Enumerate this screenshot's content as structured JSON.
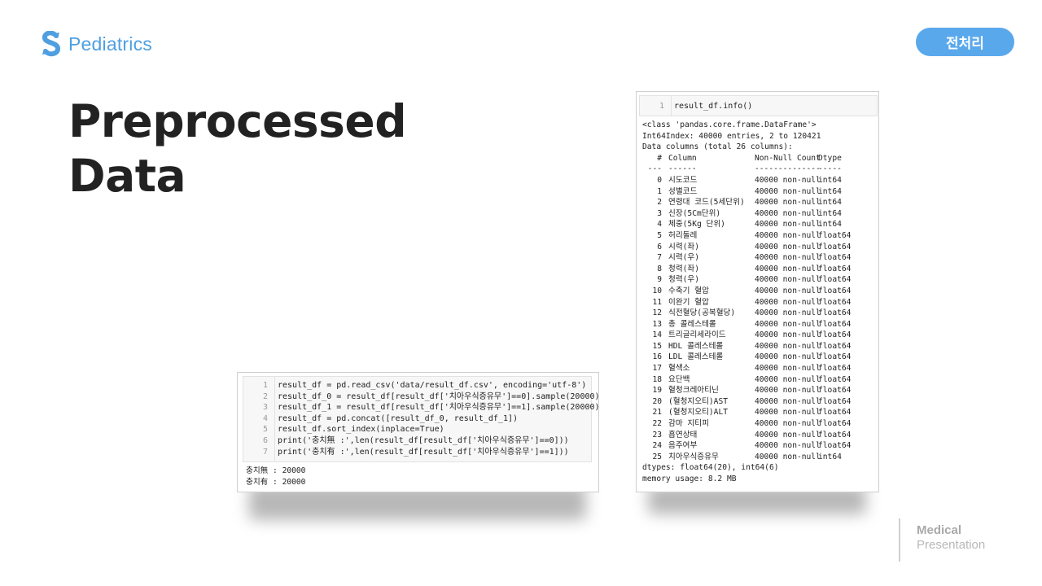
{
  "brand": {
    "name": "Pediatrics"
  },
  "tag": {
    "label": "전처리"
  },
  "title": {
    "line1": "Preprocessed",
    "line2": "Data"
  },
  "colors": {
    "accent": "#5aa8ec",
    "brand": "#4f9fe0",
    "title": "#222222"
  },
  "code_panel": {
    "lines": [
      {
        "n": "1",
        "code": "result_df = pd.read_csv('data/result_df.csv', encoding='utf-8')"
      },
      {
        "n": "2",
        "code": "result_df_0 = result_df[result_df['치아우식증유무']==0].sample(20000)"
      },
      {
        "n": "3",
        "code": "result_df_1 = result_df[result_df['치아우식증유무']==1].sample(20000)"
      },
      {
        "n": "4",
        "code": "result_df = pd.concat([result_df_0, result_df_1])"
      },
      {
        "n": "5",
        "code": "result_df.sort_index(inplace=True)"
      },
      {
        "n": "6",
        "code": "print('충치無 :',len(result_df[result_df['치아우식증유무']==0]))"
      },
      {
        "n": "7",
        "code": "print('충치有 :',len(result_df[result_df['치아우식증유무']==1]))"
      }
    ],
    "output": [
      "충치無 : 20000",
      "충치有 : 20000"
    ]
  },
  "info_panel": {
    "code_line": {
      "n": "1",
      "code": "result_df.info()"
    },
    "header_lines": [
      "<class 'pandas.core.frame.DataFrame'>",
      "Int64Index: 40000 entries, 2 to 120421",
      "Data columns (total 26 columns):"
    ],
    "columns_header": {
      "idx": "#",
      "name": "Column",
      "count": "Non-Null Count",
      "dtype": "Dtype"
    },
    "columns_sep": {
      "idx": "---",
      "name": "------",
      "count": "--------------",
      "dtype": "-----"
    },
    "rows": [
      {
        "idx": "0",
        "name": "시도코드",
        "count": "40000 non-null",
        "dtype": "int64"
      },
      {
        "idx": "1",
        "name": "성별코드",
        "count": "40000 non-null",
        "dtype": "int64"
      },
      {
        "idx": "2",
        "name": "연령대 코드(5세단위)",
        "count": "40000 non-null",
        "dtype": "int64"
      },
      {
        "idx": "3",
        "name": "신장(5Cm단위)",
        "count": "40000 non-null",
        "dtype": "int64"
      },
      {
        "idx": "4",
        "name": "체중(5Kg 단위)",
        "count": "40000 non-null",
        "dtype": "int64"
      },
      {
        "idx": "5",
        "name": "허리둘레",
        "count": "40000 non-null",
        "dtype": "float64"
      },
      {
        "idx": "6",
        "name": "시력(좌)",
        "count": "40000 non-null",
        "dtype": "float64"
      },
      {
        "idx": "7",
        "name": "시력(우)",
        "count": "40000 non-null",
        "dtype": "float64"
      },
      {
        "idx": "8",
        "name": "청력(좌)",
        "count": "40000 non-null",
        "dtype": "float64"
      },
      {
        "idx": "9",
        "name": "청력(우)",
        "count": "40000 non-null",
        "dtype": "float64"
      },
      {
        "idx": "10",
        "name": "수축기 혈압",
        "count": "40000 non-null",
        "dtype": "float64"
      },
      {
        "idx": "11",
        "name": "이완기 혈압",
        "count": "40000 non-null",
        "dtype": "float64"
      },
      {
        "idx": "12",
        "name": "식전혈당(공복혈당)",
        "count": "40000 non-null",
        "dtype": "float64"
      },
      {
        "idx": "13",
        "name": "총 콜레스테롤",
        "count": "40000 non-null",
        "dtype": "float64"
      },
      {
        "idx": "14",
        "name": "트리글리세라이드",
        "count": "40000 non-null",
        "dtype": "float64"
      },
      {
        "idx": "15",
        "name": "HDL 콜레스테롤",
        "count": "40000 non-null",
        "dtype": "float64"
      },
      {
        "idx": "16",
        "name": "LDL 콜레스테롤",
        "count": "40000 non-null",
        "dtype": "float64"
      },
      {
        "idx": "17",
        "name": "혈색소",
        "count": "40000 non-null",
        "dtype": "float64"
      },
      {
        "idx": "18",
        "name": "요단백",
        "count": "40000 non-null",
        "dtype": "float64"
      },
      {
        "idx": "19",
        "name": "혈청크레아티닌",
        "count": "40000 non-null",
        "dtype": "float64"
      },
      {
        "idx": "20",
        "name": "(혈청지오티)AST",
        "count": "40000 non-null",
        "dtype": "float64"
      },
      {
        "idx": "21",
        "name": "(혈청지오티)ALT",
        "count": "40000 non-null",
        "dtype": "float64"
      },
      {
        "idx": "22",
        "name": "감마 지티피",
        "count": "40000 non-null",
        "dtype": "float64"
      },
      {
        "idx": "23",
        "name": "흡연상태",
        "count": "40000 non-null",
        "dtype": "float64"
      },
      {
        "idx": "24",
        "name": "음주여부",
        "count": "40000 non-null",
        "dtype": "float64"
      },
      {
        "idx": "25",
        "name": "치아우식증유무",
        "count": "40000 non-null",
        "dtype": "int64"
      }
    ],
    "footer_lines": [
      "dtypes: float64(20), int64(6)",
      "memory usage: 8.2 MB"
    ]
  },
  "footer": {
    "line1": "Medical",
    "line2": "Presentation"
  }
}
